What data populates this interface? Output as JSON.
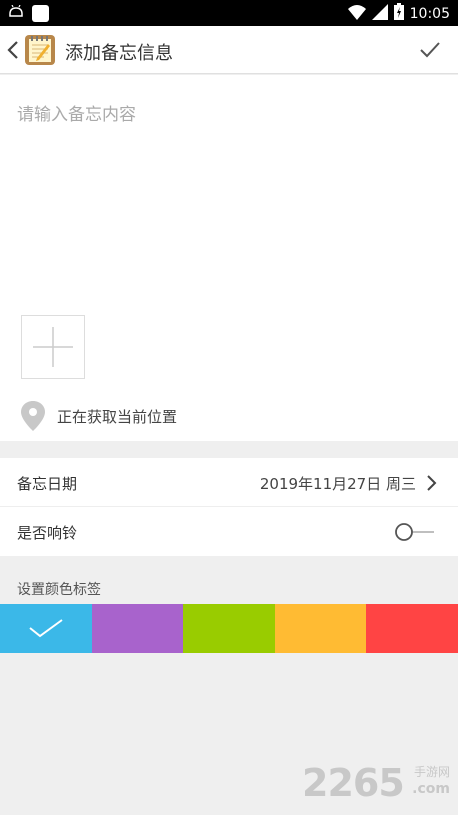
{
  "status_bar": {
    "time": "10:05",
    "icons": [
      "notification-icon",
      "app-icon",
      "wifi-icon",
      "signal-icon",
      "battery-icon"
    ]
  },
  "app_bar": {
    "title": "添加备忘信息",
    "back_icon": "chevron-left-icon",
    "logo_icon": "notepad-icon",
    "confirm_icon": "check-icon"
  },
  "editor": {
    "placeholder": "请输入备忘内容",
    "add_photo_icon": "plus-icon",
    "location_text": "正在获取当前位置"
  },
  "settings": {
    "date_label": "备忘日期",
    "date_value": "2019年11月27日 周三",
    "ring_label": "是否响铃",
    "ring_enabled": false
  },
  "color_tags": {
    "label": "设置颜色标签",
    "colors": [
      "#3bb8e8",
      "#a863cc",
      "#99cc00",
      "#ffbb33",
      "#ff4444"
    ],
    "selected_index": 0
  },
  "watermark": {
    "number": "2265",
    "cn": "手游网",
    "en": ".com"
  }
}
